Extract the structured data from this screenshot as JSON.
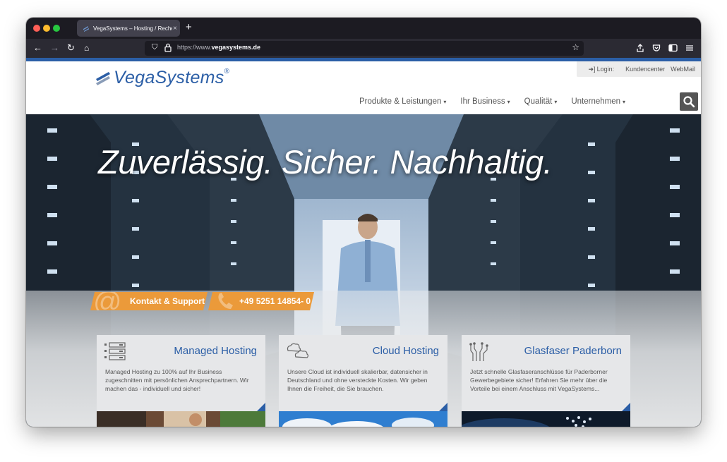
{
  "browser": {
    "tab_title": "VegaSystems – Hosting / Rechenzentrum",
    "tab_close": "×",
    "new_tab": "+",
    "url_prefix": "https://www.",
    "url_domain": "vegasystems.de"
  },
  "header": {
    "login": "Login:",
    "kundencenter": "Kundencenter",
    "webmail": "WebMail",
    "logo_text": "VegaSystems",
    "logo_reg": "®"
  },
  "nav": {
    "items": [
      "Produkte & Leistungen",
      "Ihr Business",
      "Qualität",
      "Unternehmen"
    ],
    "caret": "▾"
  },
  "hero": {
    "headline": "Zuverlässig. Sicher. Nachhaltig.",
    "contact_button": "Kontakt & Support",
    "phone_button": "+49 5251 14854- 0"
  },
  "cards": [
    {
      "title": "Managed Hosting",
      "text": "Managed Hosting zu 100% auf Ihr Business zugeschnitten mit persönlichen Ansprechpartnern. Wir machen das - individuell und sicher!",
      "icon": "server-stack-icon"
    },
    {
      "title": "Cloud Hosting",
      "text": "Unsere Cloud ist individuell skalierbar, datensicher in Deutschland und ohne versteckte Kosten. Wir geben Ihnen die Freiheit, die Sie brauchen.",
      "icon": "clouds-icon"
    },
    {
      "title": "Glasfaser Paderborn",
      "text": "Jetzt schnelle Glasfaseranschlüsse für Paderborner Gewerbegebiete sicher! Erfahren Sie mehr über die Vorteile bei einem Anschluss mit VegaSystems...",
      "icon": "fiber-icon"
    }
  ],
  "colors": {
    "brand_blue": "#2b5ea6",
    "accent_orange": "#eb9a3a",
    "nav_text": "#555555"
  }
}
